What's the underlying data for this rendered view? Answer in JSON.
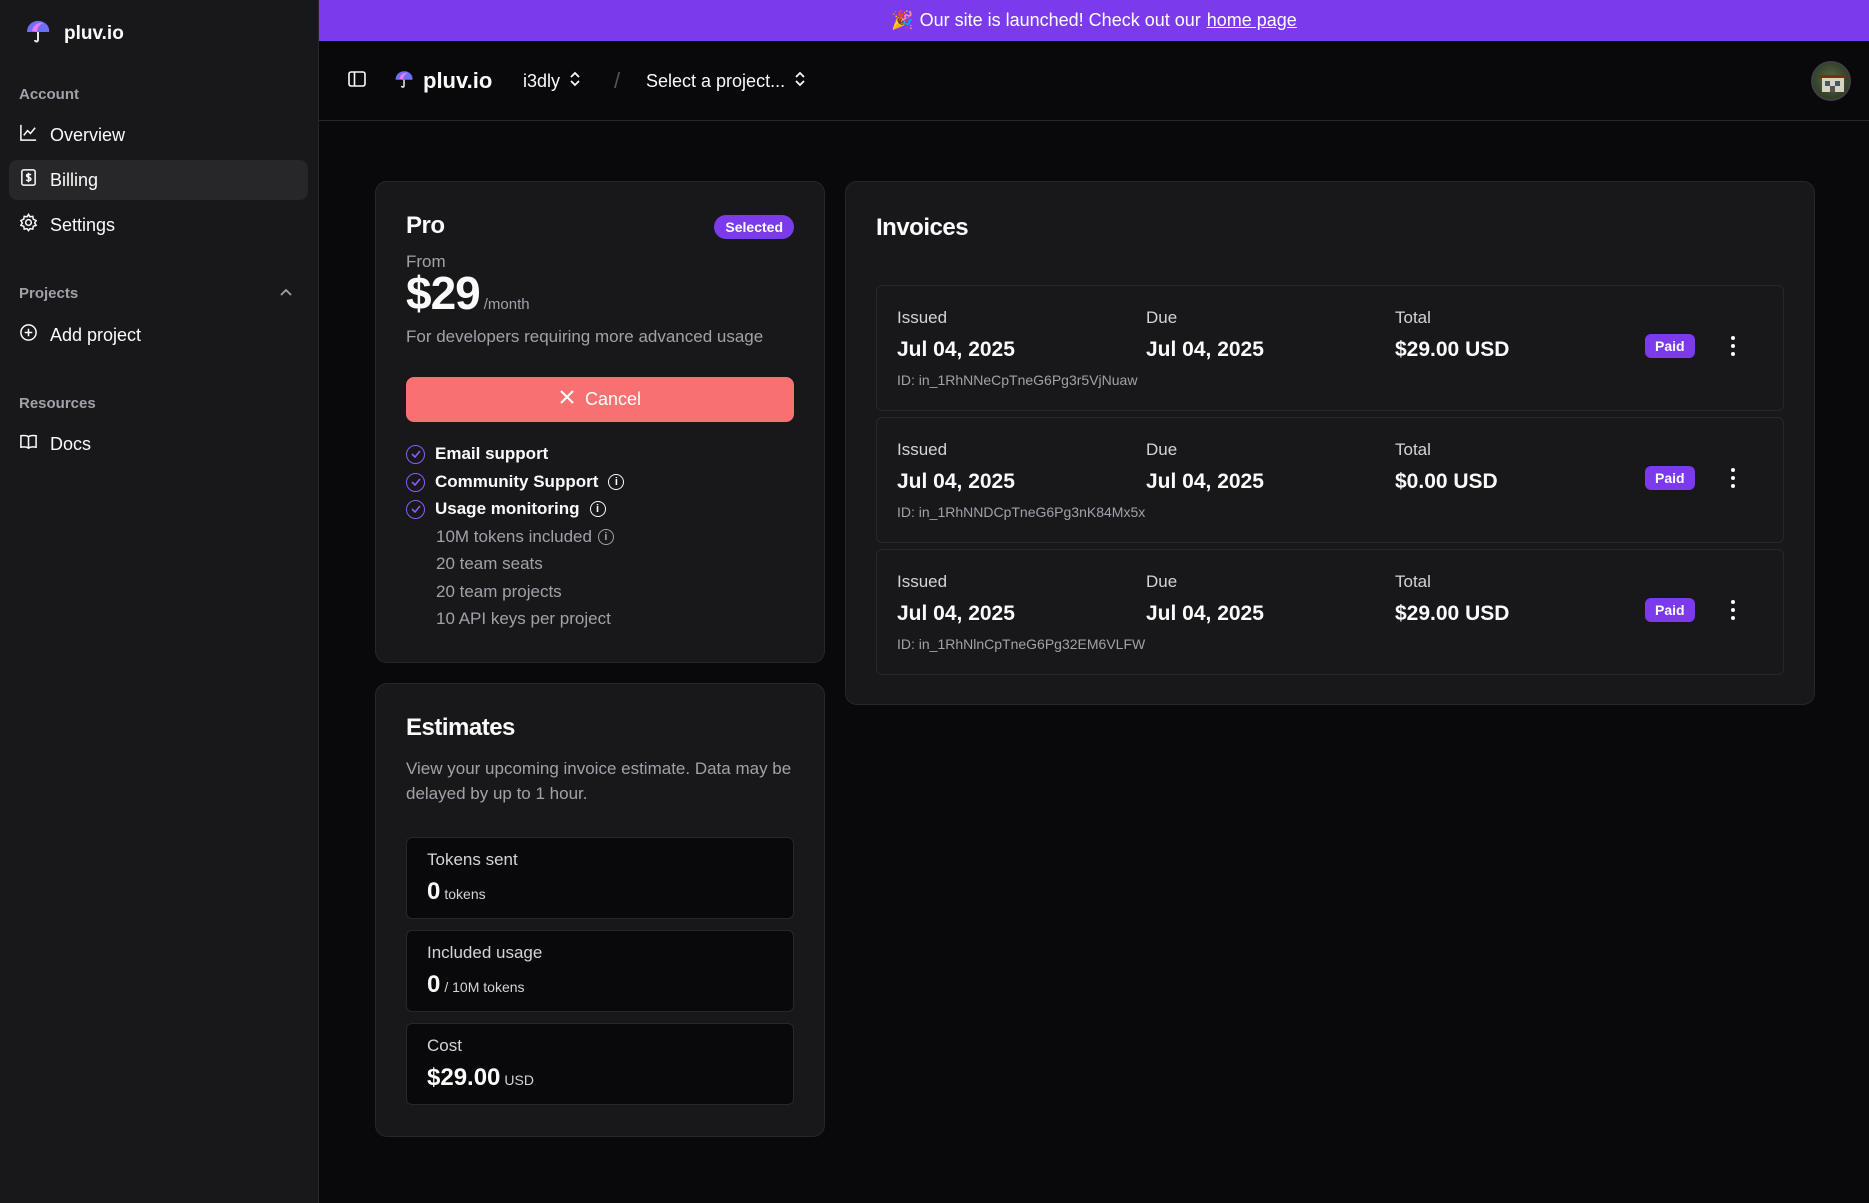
{
  "banner": {
    "emoji": "🎉",
    "text": "Our site is launched! Check out our",
    "link": "home page"
  },
  "sidebar": {
    "brand": "pluv.io",
    "account_label": "Account",
    "account_items": [
      {
        "label": "Overview",
        "icon": "chart-line-icon"
      },
      {
        "label": "Billing",
        "icon": "receipt-icon",
        "active": true
      },
      {
        "label": "Settings",
        "icon": "gear-icon"
      }
    ],
    "projects_label": "Projects",
    "projects_items": [
      {
        "label": "Add project",
        "icon": "plus-circle-icon"
      }
    ],
    "resources_label": "Resources",
    "resources_items": [
      {
        "label": "Docs",
        "icon": "book-icon"
      }
    ]
  },
  "topbar": {
    "brand": "pluv.io",
    "org": "i3dly",
    "separator": "/",
    "project_select": "Select a project..."
  },
  "plan": {
    "name": "Pro",
    "badge": "Selected",
    "from_label": "From",
    "price": "$29",
    "period": "/month",
    "description": "For developers requiring more advanced usage",
    "cancel_label": "Cancel",
    "features": [
      "Email support",
      "Community Support",
      "Usage monitoring"
    ],
    "subfeatures": [
      "10M tokens included",
      "20 team seats",
      "20 team projects",
      "10 API keys per project"
    ]
  },
  "estimates": {
    "title": "Estimates",
    "description": "View your upcoming invoice estimate. Data may be delayed by up to 1 hour.",
    "tokens_sent": {
      "label": "Tokens sent",
      "value": "0",
      "unit": "tokens"
    },
    "included_usage": {
      "label": "Included usage",
      "value": "0",
      "unit": "/ 10M tokens"
    },
    "cost": {
      "label": "Cost",
      "value": "$29.00",
      "unit": "USD"
    }
  },
  "invoices": {
    "title": "Invoices",
    "issued_label": "Issued",
    "due_label": "Due",
    "total_label": "Total",
    "rows": [
      {
        "issued": "Jul 04, 2025",
        "due": "Jul 04, 2025",
        "total": "$29.00 USD",
        "id": "ID: in_1RhNNeCpTneG6Pg3r5VjNuaw",
        "status": "Paid"
      },
      {
        "issued": "Jul 04, 2025",
        "due": "Jul 04, 2025",
        "total": "$0.00 USD",
        "id": "ID: in_1RhNNDCpTneG6Pg3nK84Mx5x",
        "status": "Paid"
      },
      {
        "issued": "Jul 04, 2025",
        "due": "Jul 04, 2025",
        "total": "$29.00 USD",
        "id": "ID: in_1RhNlnCpTneG6Pg32EM6VLFW",
        "status": "Paid"
      }
    ]
  },
  "colors": {
    "accent": "#7c3aed",
    "danger": "#f87171",
    "background": "#09090b",
    "surface": "#18181b"
  }
}
